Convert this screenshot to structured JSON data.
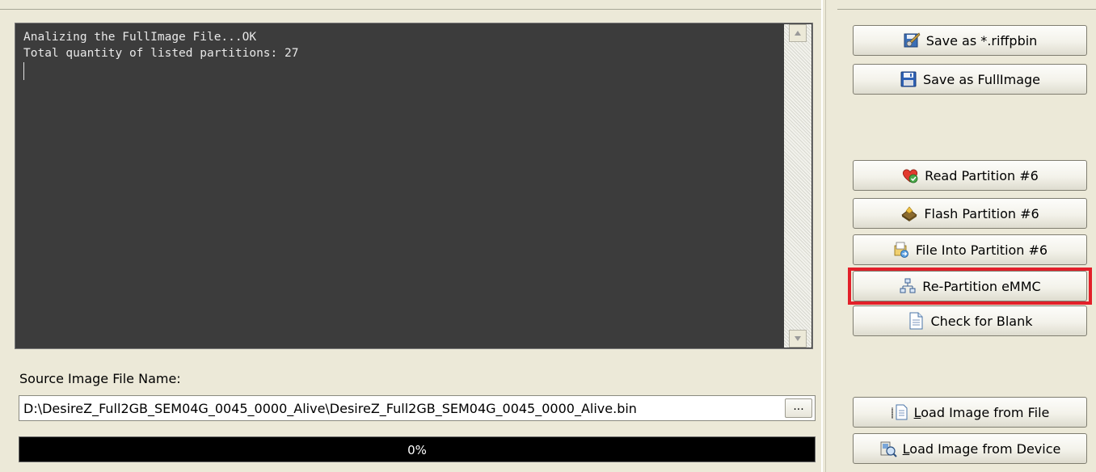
{
  "console": {
    "lines": [
      "Analizing the FullImage File...OK",
      "Total quantity of listed partitions: 27"
    ]
  },
  "source": {
    "label": "Source Image File Name:",
    "path": "D:\\DesireZ_Full2GB_SEM04G_0045_0000_Alive\\DesireZ_Full2GB_SEM04G_0045_0000_Alive.bin",
    "browse_label": "..."
  },
  "progress": {
    "value": 0,
    "text": "0%"
  },
  "buttons": {
    "save_riffpbin": {
      "label": "Save as *.riffpbin",
      "icon": "wrench-save-icon"
    },
    "save_fullimage": {
      "label": "Save as FullImage",
      "icon": "floppy-disk-icon"
    },
    "read_partition": {
      "label": "Read Partition #6",
      "icon": "heart-read-icon"
    },
    "flash_partition": {
      "label": "Flash Partition #6",
      "icon": "chip-flash-icon"
    },
    "file_into_partition": {
      "label": "File Into Partition #6",
      "icon": "file-import-icon"
    },
    "repartition": {
      "label": "Re-Partition eMMC",
      "icon": "network-tree-icon"
    },
    "check_blank": {
      "label": "Check for Blank",
      "icon": "document-icon"
    },
    "load_file": {
      "label_mnemonic": "L",
      "label_rest": "oad Image from File",
      "icon": "file-load-icon"
    },
    "load_device": {
      "label_mnemonic": "L",
      "label_rest": "oad Image from Device",
      "icon": "device-search-icon"
    }
  },
  "colors": {
    "console_bg": "#3c3c3c",
    "highlight": "#e2202a",
    "window_bg": "#ece9d8"
  }
}
